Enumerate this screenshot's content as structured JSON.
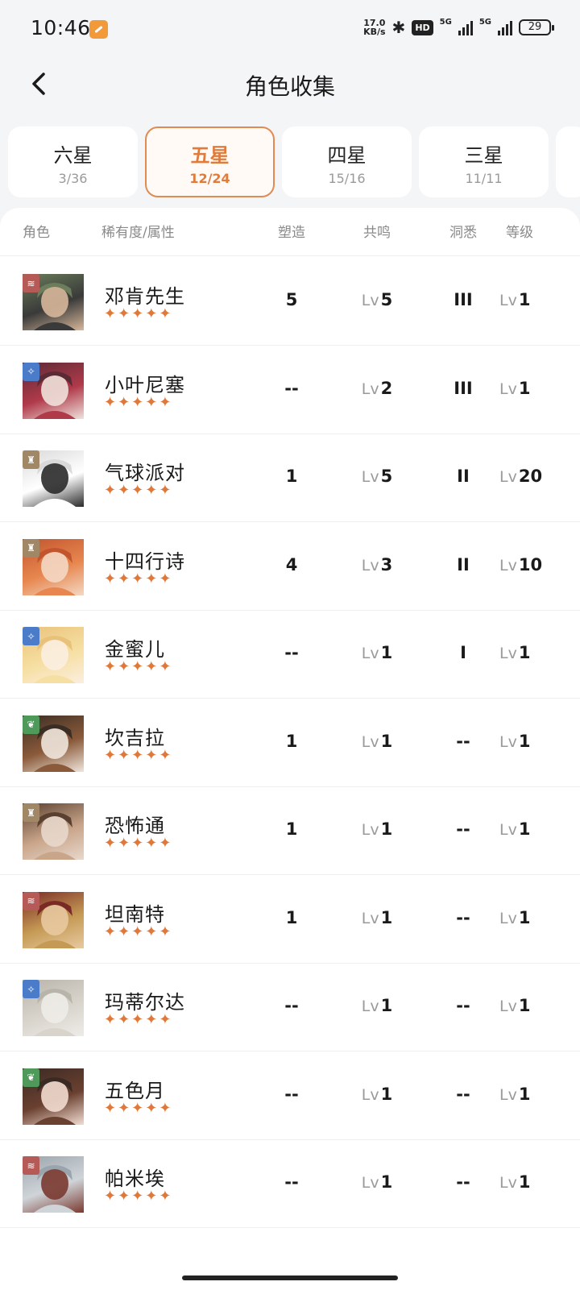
{
  "status_bar": {
    "time": "10:46",
    "net_speed_value": "17.0",
    "net_speed_unit": "KB/s",
    "hd_badge": "HD",
    "signal_1": "5G",
    "signal_2": "5G",
    "battery": "29"
  },
  "header": {
    "title": "角色收集"
  },
  "tabs": [
    {
      "name": "六星",
      "count": "3/36"
    },
    {
      "name": "五星",
      "count": "12/24",
      "active": true
    },
    {
      "name": "四星",
      "count": "15/16"
    },
    {
      "name": "三星",
      "count": "11/11"
    }
  ],
  "columns": {
    "role": "角色",
    "rarity": "稀有度/属性",
    "shape": "塑造",
    "resonance": "共鸣",
    "insight": "洞悉",
    "level": "等级"
  },
  "lv_prefix": "Lv",
  "star_glyphs": "✦✦✦✦✦",
  "colors": {
    "accent": "#e07b3c",
    "element_red": "#b65a57",
    "element_blue": "#4a7cc9",
    "element_gold": "#a08866",
    "element_green": "#4f9a5a"
  },
  "characters": [
    {
      "name": "邓肯先生",
      "element": "red",
      "element_icon": "wave-icon",
      "shape": "5",
      "resonance": "5",
      "insight": "III",
      "level": "1"
    },
    {
      "name": "小叶尼塞",
      "element": "blue",
      "element_icon": "star-icon",
      "shape": "--",
      "resonance": "2",
      "insight": "III",
      "level": "1"
    },
    {
      "name": "气球派对",
      "element": "gold",
      "element_icon": "beast-icon",
      "shape": "1",
      "resonance": "5",
      "insight": "II",
      "level": "20"
    },
    {
      "name": "十四行诗",
      "element": "gold",
      "element_icon": "beast-icon",
      "shape": "4",
      "resonance": "3",
      "insight": "II",
      "level": "10"
    },
    {
      "name": "金蜜儿",
      "element": "blue",
      "element_icon": "star-icon",
      "shape": "--",
      "resonance": "1",
      "insight": "I",
      "level": "1"
    },
    {
      "name": "坎吉拉",
      "element": "green",
      "element_icon": "leaf-icon",
      "shape": "1",
      "resonance": "1",
      "insight": "--",
      "level": "1"
    },
    {
      "name": "恐怖通",
      "element": "gold",
      "element_icon": "beast-icon",
      "shape": "1",
      "resonance": "1",
      "insight": "--",
      "level": "1"
    },
    {
      "name": "坦南特",
      "element": "red",
      "element_icon": "wave-icon",
      "shape": "1",
      "resonance": "1",
      "insight": "--",
      "level": "1"
    },
    {
      "name": "玛蒂尔达",
      "element": "blue",
      "element_icon": "star-icon",
      "shape": "--",
      "resonance": "1",
      "insight": "--",
      "level": "1"
    },
    {
      "name": "五色月",
      "element": "green",
      "element_icon": "leaf-icon",
      "shape": "--",
      "resonance": "1",
      "insight": "--",
      "level": "1"
    },
    {
      "name": "帕米埃",
      "element": "red",
      "element_icon": "wave-icon",
      "shape": "--",
      "resonance": "1",
      "insight": "--",
      "level": "1"
    }
  ]
}
